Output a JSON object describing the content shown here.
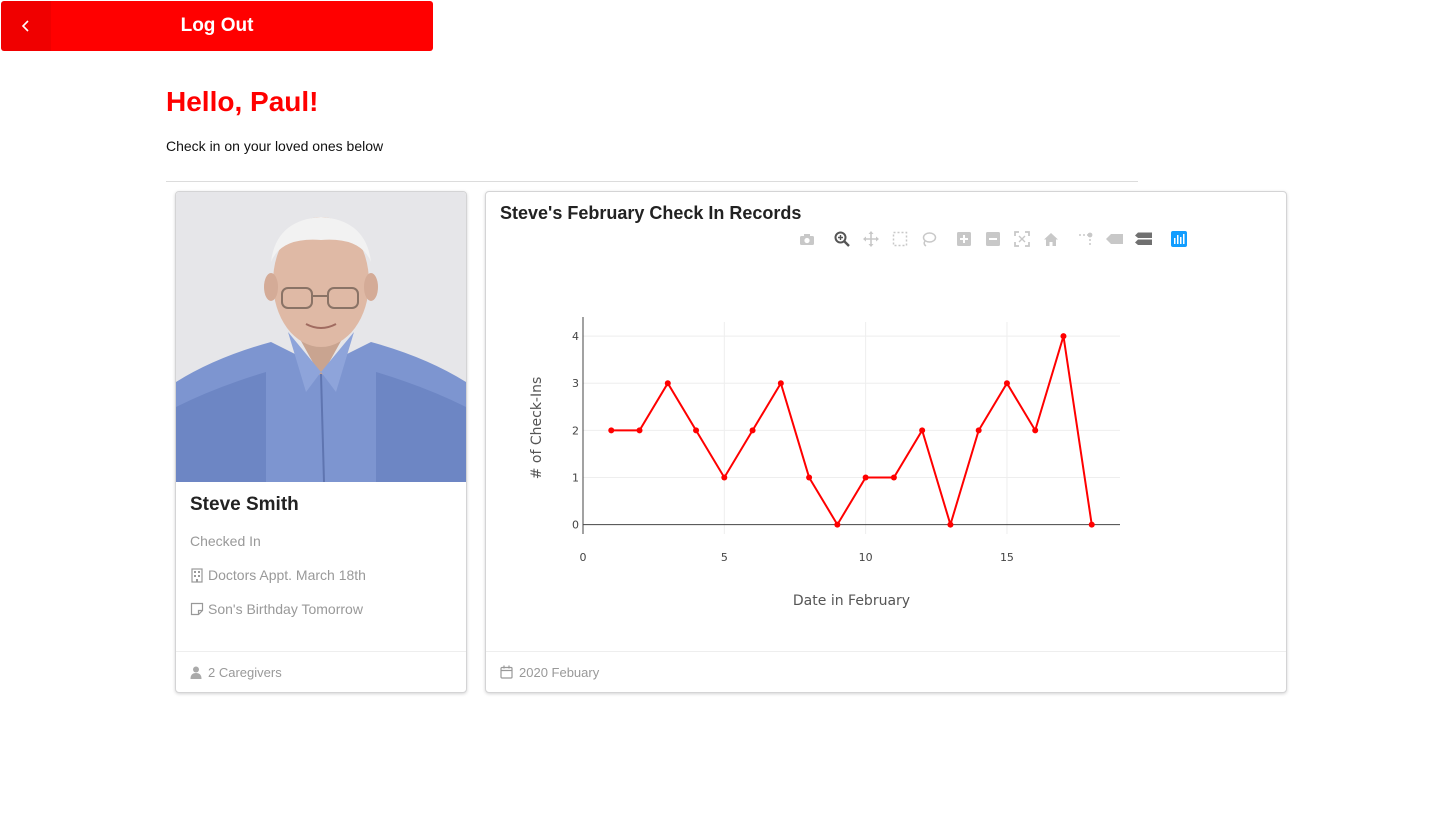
{
  "header": {
    "logout_label": "Log Out"
  },
  "greeting": "Hello, Paul!",
  "subtitle": "Check in on your loved ones below",
  "person": {
    "name": "Steve Smith",
    "status": "Checked In",
    "appointment": "Doctors Appt. March 18th",
    "note": "Son's Birthday Tomorrow",
    "caregivers": "2 Caregivers"
  },
  "chart_card": {
    "title": "Steve's February Check In Records",
    "footer": "2020 Febuary",
    "modebar_icons": [
      "camera-icon",
      "zoom-icon",
      "pan-icon",
      "box-select-icon",
      "lasso-select-icon",
      "zoom-in-icon",
      "zoom-out-icon",
      "autoscale-icon",
      "reset-axes-icon",
      "spike-lines-icon",
      "hover-closest-icon",
      "hover-compare-icon",
      "plotly-logo-icon"
    ]
  },
  "colors": {
    "accent": "#ff0000",
    "line": "#ff0000",
    "muted": "#999999"
  },
  "chart_data": {
    "type": "line",
    "x": [
      1,
      2,
      3,
      4,
      5,
      6,
      7,
      8,
      9,
      10,
      11,
      12,
      13,
      14,
      15,
      16,
      17,
      18
    ],
    "y": [
      2,
      2,
      3,
      2,
      1,
      2,
      3,
      1,
      0,
      1,
      1,
      2,
      0,
      2,
      3,
      2,
      4,
      0
    ],
    "xlabel": "Date in February",
    "ylabel": "# of Check-Ins",
    "xlim": [
      0,
      19
    ],
    "ylim": [
      -0.2,
      4.3
    ],
    "xticks": [
      0,
      5,
      10,
      15
    ],
    "yticks": [
      0,
      1,
      2,
      3,
      4
    ],
    "grid": true,
    "legend": "none"
  }
}
